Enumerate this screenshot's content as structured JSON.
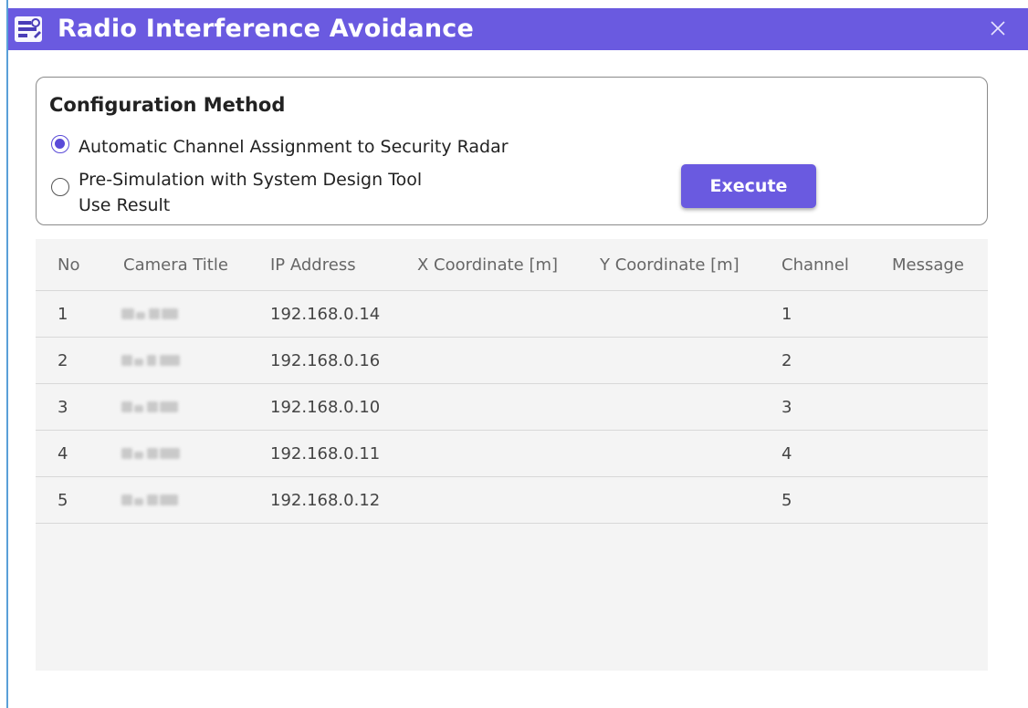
{
  "window": {
    "title": "Radio Interference Avoidance",
    "title_icon": "radar-settings-icon",
    "close_icon": "close-icon",
    "accent_color": "#6a5ae0"
  },
  "config": {
    "heading": "Configuration Method",
    "options": [
      {
        "label": "Automatic Channel Assignment to Security Radar",
        "checked": true
      },
      {
        "label_line1": "Pre-Simulation with System Design Tool",
        "label_line2": "Use Result",
        "checked": false
      }
    ],
    "execute_label": "Execute"
  },
  "table": {
    "columns": [
      "No",
      "Camera Title",
      "IP Address",
      "X Coordinate [m]",
      "Y Coordinate [m]",
      "Channel",
      "Message"
    ],
    "rows": [
      {
        "no": "1",
        "camera_title": "",
        "ip": "192.168.0.14",
        "x": "",
        "y": "",
        "channel": "1",
        "message": ""
      },
      {
        "no": "2",
        "camera_title": "",
        "ip": "192.168.0.16",
        "x": "",
        "y": "",
        "channel": "2",
        "message": ""
      },
      {
        "no": "3",
        "camera_title": "",
        "ip": "192.168.0.10",
        "x": "",
        "y": "",
        "channel": "3",
        "message": ""
      },
      {
        "no": "4",
        "camera_title": "",
        "ip": "192.168.0.11",
        "x": "",
        "y": "",
        "channel": "4",
        "message": ""
      },
      {
        "no": "5",
        "camera_title": "",
        "ip": "192.168.0.12",
        "x": "",
        "y": "",
        "channel": "5",
        "message": ""
      }
    ]
  }
}
